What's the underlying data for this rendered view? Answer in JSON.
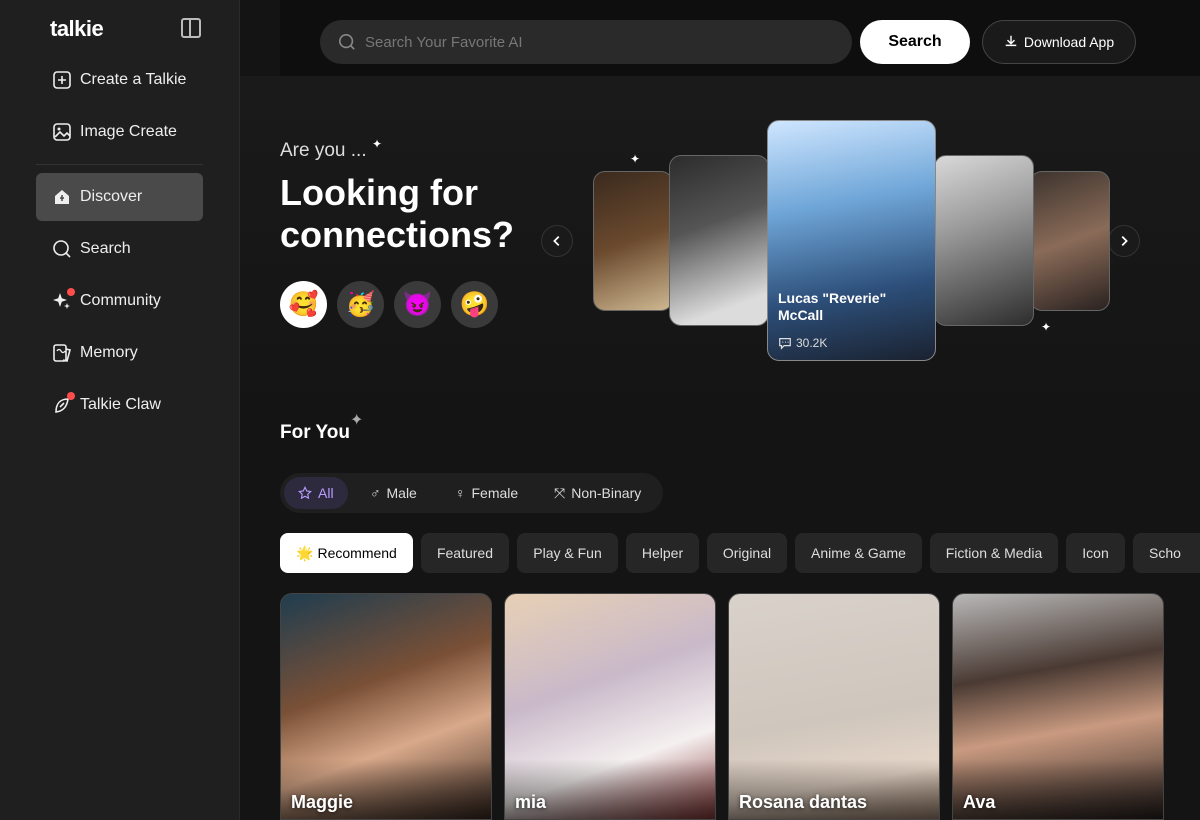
{
  "brand": {
    "logo": "talkie"
  },
  "sidebar": {
    "items": [
      {
        "label": "Create a Talkie",
        "icon": "plus-square-icon"
      },
      {
        "label": "Image Create",
        "icon": "image-icon"
      },
      {
        "label": "Discover",
        "icon": "home-icon",
        "active": true
      },
      {
        "label": "Search",
        "icon": "search-icon"
      },
      {
        "label": "Community",
        "icon": "sparkle-icon",
        "notification": true
      },
      {
        "label": "Memory",
        "icon": "memory-icon"
      },
      {
        "label": "Talkie Claw",
        "icon": "claw-icon",
        "notification": true
      }
    ]
  },
  "header": {
    "search_placeholder": "Search Your Favorite AI",
    "search_button": "Search",
    "download_button": "Download App"
  },
  "hero": {
    "pre_title": "Are you ...",
    "title": "Looking for connections?",
    "emojis": [
      "🥰",
      "🥳",
      "😈",
      "🤪"
    ],
    "featured_card": {
      "name": "Lucas \"Reverie\" McCall",
      "chats": "30.2K"
    }
  },
  "for_you": {
    "title": "For You",
    "gender_tabs": [
      "All",
      "Male",
      "Female",
      "Non-Binary"
    ],
    "categories": [
      "🌟 Recommend",
      "Featured",
      "Play & Fun",
      "Helper",
      "Original",
      "Anime & Game",
      "Fiction & Media",
      "Icon",
      "Scho"
    ],
    "characters": [
      "Maggie",
      "mia",
      "Rosana dantas",
      "Ava"
    ]
  },
  "colors": {
    "accent": "#b89cff",
    "active_nav": "#4a4a4a",
    "notification": "#ff4d4d"
  }
}
